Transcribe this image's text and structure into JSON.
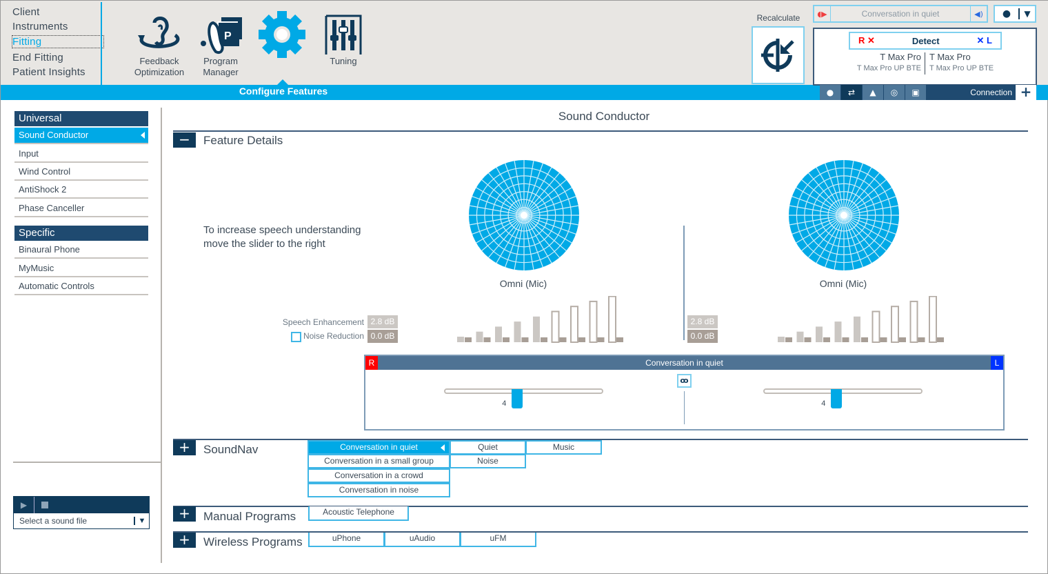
{
  "nav": {
    "items": [
      {
        "label": "Client",
        "active": false
      },
      {
        "label": "Instruments",
        "active": false
      },
      {
        "label": "Fitting",
        "active": true
      },
      {
        "label": "End Fitting",
        "active": false
      },
      {
        "label": "Patient Insights",
        "active": false
      }
    ]
  },
  "tools": {
    "feedback": {
      "line1": "Feedback",
      "line2": "Optimization"
    },
    "program_manager": {
      "line1": "Program",
      "line2": "Manager"
    },
    "configure": {
      "label": "Configure Features"
    },
    "tuning": {
      "label": "Tuning"
    }
  },
  "header_right": {
    "recalculate_label": "Recalculate",
    "current_program": "Conversation in quiet",
    "detect": {
      "left_tag": "R",
      "label": "Detect",
      "right_tag": "L"
    },
    "devices": {
      "right": {
        "name": "T Max Pro",
        "model": "T Max Pro UP BTE"
      },
      "left": {
        "name": "T Max Pro",
        "model": "T Max Pro UP BTE"
      }
    },
    "status_icons": [
      "person-icon",
      "swap-icon",
      "warning-icon",
      "compass-icon",
      "remote-help-icon"
    ],
    "connection_label": "Connection",
    "connection_plus": "+"
  },
  "sidebar": {
    "groups": [
      {
        "title": "Universal",
        "items": [
          {
            "label": "Sound Conductor",
            "selected": true
          },
          {
            "label": "Input",
            "selected": false
          },
          {
            "label": "Wind Control",
            "selected": false
          },
          {
            "label": "AntiShock 2",
            "selected": false
          },
          {
            "label": "Phase Canceller",
            "selected": false
          }
        ]
      },
      {
        "title": "Specific",
        "items": [
          {
            "label": "Binaural Phone",
            "selected": false
          },
          {
            "label": "MyMusic",
            "selected": false
          },
          {
            "label": "Automatic Controls",
            "selected": false
          }
        ]
      }
    ],
    "player": {
      "select_placeholder": "Select a sound file"
    }
  },
  "main": {
    "title": "Sound Conductor",
    "feature_details": {
      "label": "Feature Details",
      "toggle": "−",
      "hint_line1": "To increase speech understanding",
      "hint_line2": "move the slider to the right",
      "right_side": {
        "pattern_label": "Omni (Mic)",
        "speech_enhancement": "2.8 dB",
        "noise_reduction": "0.0 dB"
      },
      "left_side": {
        "pattern_label": "Omni (Mic)",
        "speech_enhancement": "2.8 dB",
        "noise_reduction": "0.0 dB"
      },
      "speech_enhancement_label": "Speech Enhancement",
      "noise_reduction_label": "Noise Reduction",
      "noise_reduction_checked": false,
      "bar_steps": 9,
      "filled_steps": 5
    },
    "slider_panel": {
      "title": "Conversation in quiet",
      "right_tag": "R",
      "left_tag": "L",
      "right_value": "4",
      "left_value": "4",
      "position_fraction": 0.46,
      "linked": true
    },
    "soundnav": {
      "label": "SoundNav",
      "toggle": "+",
      "col1": [
        "Conversation in quiet",
        "Conversation in a small group",
        "Conversation in a crowd",
        "Conversation in noise"
      ],
      "col2": [
        "Quiet",
        "Noise"
      ],
      "col3": [
        "Music"
      ],
      "selected": "Conversation in quiet"
    },
    "manual_programs": {
      "label": "Manual Programs",
      "toggle": "+",
      "items": [
        "Acoustic Telephone"
      ]
    },
    "wireless_programs": {
      "label": "Wireless Programs",
      "toggle": "+",
      "items": [
        "uPhone",
        "uAudio",
        "uFM"
      ]
    }
  },
  "colors": {
    "accent": "#00a9e6",
    "navy": "#0f3a5a",
    "right_ear": "#ff0000",
    "left_ear": "#0033ff"
  }
}
